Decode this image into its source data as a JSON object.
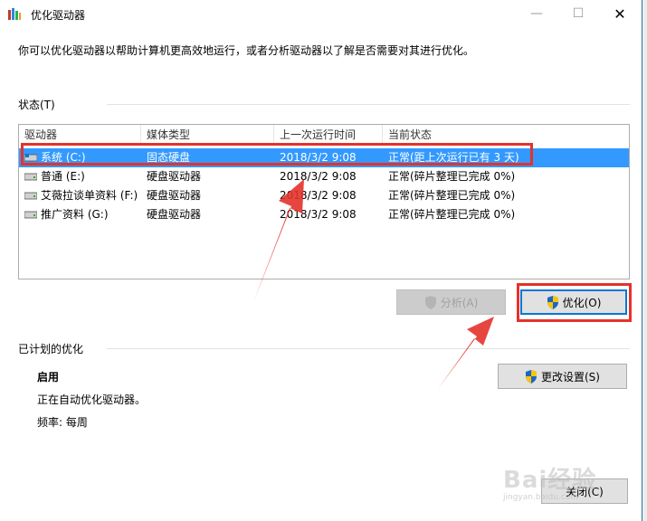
{
  "window": {
    "title": "优化驱动器",
    "controls": {
      "minimize": "—",
      "maximize": "☐",
      "close": "✕"
    }
  },
  "intro_text": "你可以优化驱动器以帮助计算机更高效地运行，或者分析驱动器以了解是否需要对其进行优化。",
  "status_section": {
    "title": "状态(T)",
    "columns": [
      "驱动器",
      "媒体类型",
      "上一次运行时间",
      "当前状态"
    ],
    "rows": [
      {
        "drive": "系统 (C:)",
        "media": "固态硬盘",
        "last_run": "2018/3/2 9:08",
        "status": "正常(距上次运行已有 3 天)",
        "selected": true
      },
      {
        "drive": "普通 (E:)",
        "media": "硬盘驱动器",
        "last_run": "2018/3/2 9:08",
        "status": "正常(碎片整理已完成 0%)",
        "selected": false
      },
      {
        "drive": "艾薇拉谈单资料 (F:)",
        "media": "硬盘驱动器",
        "last_run": "2018/3/2 9:08",
        "status": "正常(碎片整理已完成 0%)",
        "selected": false
      },
      {
        "drive": "推广资料 (G:)",
        "media": "硬盘驱动器",
        "last_run": "2018/3/2 9:08",
        "status": "正常(碎片整理已完成 0%)",
        "selected": false
      }
    ]
  },
  "buttons": {
    "analyze": "分析(A)",
    "optimize": "优化(O)",
    "change_settings": "更改设置(S)",
    "close": "关闭(C)"
  },
  "schedule_section": {
    "title": "已计划的优化",
    "state": "启用",
    "description": "正在自动优化驱动器。",
    "frequency": "频率: 每周"
  },
  "watermark": {
    "brand": "Bai经验",
    "url": "jingyan.baidu.com"
  },
  "colors": {
    "selection": "#3399ff",
    "callout": "#e4322b",
    "accent": "#0078d7"
  }
}
